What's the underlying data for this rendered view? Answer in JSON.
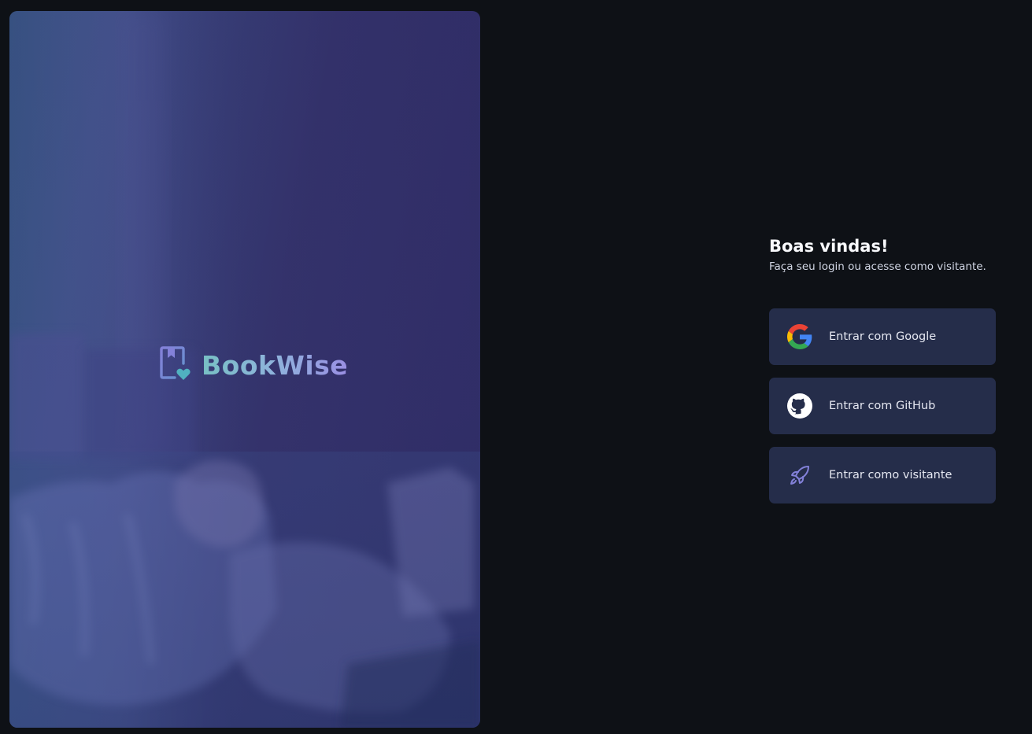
{
  "brand": {
    "name": "BookWise",
    "logo_icon": "book-heart-icon",
    "gradient_colors": [
      "#78c0c4",
      "#9a8fe3"
    ]
  },
  "hero": {
    "image": "person-reading-on-couch-photo",
    "overlay_color": "#302d62"
  },
  "login": {
    "title": "Boas vindas!",
    "subtitle": "Faça seu login ou acesse como visitante.",
    "buttons": [
      {
        "label": "Entrar com Google",
        "icon": "google-icon"
      },
      {
        "label": "Entrar com GitHub",
        "icon": "github-icon"
      },
      {
        "label": "Entrar como visitante",
        "icon": "rocket-icon"
      }
    ]
  },
  "colors": {
    "background": "#0e1116",
    "button_background": "#252d4a",
    "title_text": "#f8f9fc",
    "accent_purple": "#8381d9"
  }
}
